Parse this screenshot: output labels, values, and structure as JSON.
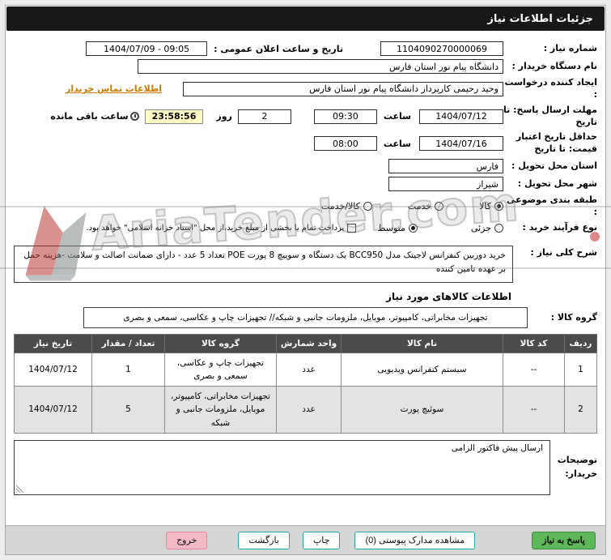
{
  "header": {
    "title": "جزئیات اطلاعات نیاز"
  },
  "form": {
    "need_number": {
      "label": "شماره نیاز :",
      "value": "1104090270000069"
    },
    "announce": {
      "label": "تاریخ و ساعت اعلان عمومی :",
      "value": "1404/07/09 - 09:05"
    },
    "buyer_org": {
      "label": "نام دستگاه خریدار :",
      "value": "دانشگاه پیام نور استان فارس"
    },
    "creator": {
      "label": "ایجاد کننده درخواست :",
      "value": "وحید رحیمی کارپرداز دانشگاه پیام نور استان فارس",
      "contact_link": "اطلاعات تماس خریدار"
    },
    "deadline": {
      "label": "مهلت ارسال پاسخ: تا تاریخ",
      "date": "1404/07/12",
      "hour_label": "ساعت",
      "time": "09:30",
      "days_value": "2",
      "days_label": "روز",
      "remaining": "23:58:56",
      "remaining_label": "ساعت باقی مانده"
    },
    "price_validity": {
      "label": "حداقل تاریخ اعتبار قیمت: تا تاریخ",
      "date": "1404/07/16",
      "hour_label": "ساعت",
      "time": "08:00"
    },
    "province": {
      "label": "استان محل تحویل :",
      "value": "فارس"
    },
    "city": {
      "label": "شهر محل تحویل :",
      "value": "شیراز"
    },
    "classification": {
      "label": "طبقه بندی موضوعی :",
      "options": [
        {
          "label": "کالا",
          "checked": true
        },
        {
          "label": "خدمت",
          "checked": false
        },
        {
          "label": "کالا/خدمت",
          "checked": false
        }
      ]
    },
    "process_type": {
      "label": "نوع فرآیند خرید :",
      "options": [
        {
          "label": "جزئی",
          "checked": false
        },
        {
          "label": "متوسط",
          "checked": true
        }
      ],
      "treasury_note": "پرداخت تمام یا بخشی از مبلغ خرید،از محل \"اسناد خزانه اسلامی\" خواهد بود."
    }
  },
  "description": {
    "label": "شرح کلی نیاز :",
    "value": "خرید دوربین کنفرانس لاجیتک مدل BCC950 یک دستگاه و سوییچ 8 پورت POE تعداد 5 عدد - دارای ضمانت اصالت و سلامت -هزینه حمل بر عهده تامین کننده"
  },
  "goods_section": {
    "title": "اطلاعات کالاهای مورد نیاز",
    "group_label": "گروه کالا :",
    "group_value": "تجهیزات مخابراتی، کامپیوتر، موبایل، ملزومات جانبی و شبکه// تجهیزات چاپ و عکاسی، سمعی و بصری"
  },
  "table": {
    "headers": [
      "ردیف",
      "کد کالا",
      "نام کالا",
      "واحد شمارش",
      "گروه کالا",
      "تعداد / مقدار",
      "تاریخ نیاز"
    ],
    "rows": [
      [
        "1",
        "--",
        "سیستم کنفرانس ویدیویی",
        "عدد",
        "تجهیزات چاپ و عکاسی، سمعی و بصری",
        "1",
        "1404/07/12"
      ],
      [
        "2",
        "--",
        "سوئیچ پورت",
        "عدد",
        "تجهیزات مخابراتی، کامپیوتر، موبایل، ملزومات جانبی و شبکه",
        "5",
        "1404/07/12"
      ]
    ]
  },
  "buyer_notes": {
    "label": "توضیحات خریدار:",
    "value": "ارسال پیش فاکتور الزامی"
  },
  "footer": {
    "respond": "پاسخ به نیاز",
    "attachments": "مشاهده مدارک پیوستی (0)",
    "print": "چاپ",
    "back": "بازگشت",
    "exit": "خروج"
  },
  "watermark": {
    "text": "AriaTender.com"
  },
  "colors": {
    "accent_teal": "#27a7a7",
    "green": "#5eb85a",
    "pink": "#f5b9c5",
    "header_dark": "#181818",
    "highlight_yellow": "#ffffc6",
    "link_orange": "#cc7a00"
  }
}
